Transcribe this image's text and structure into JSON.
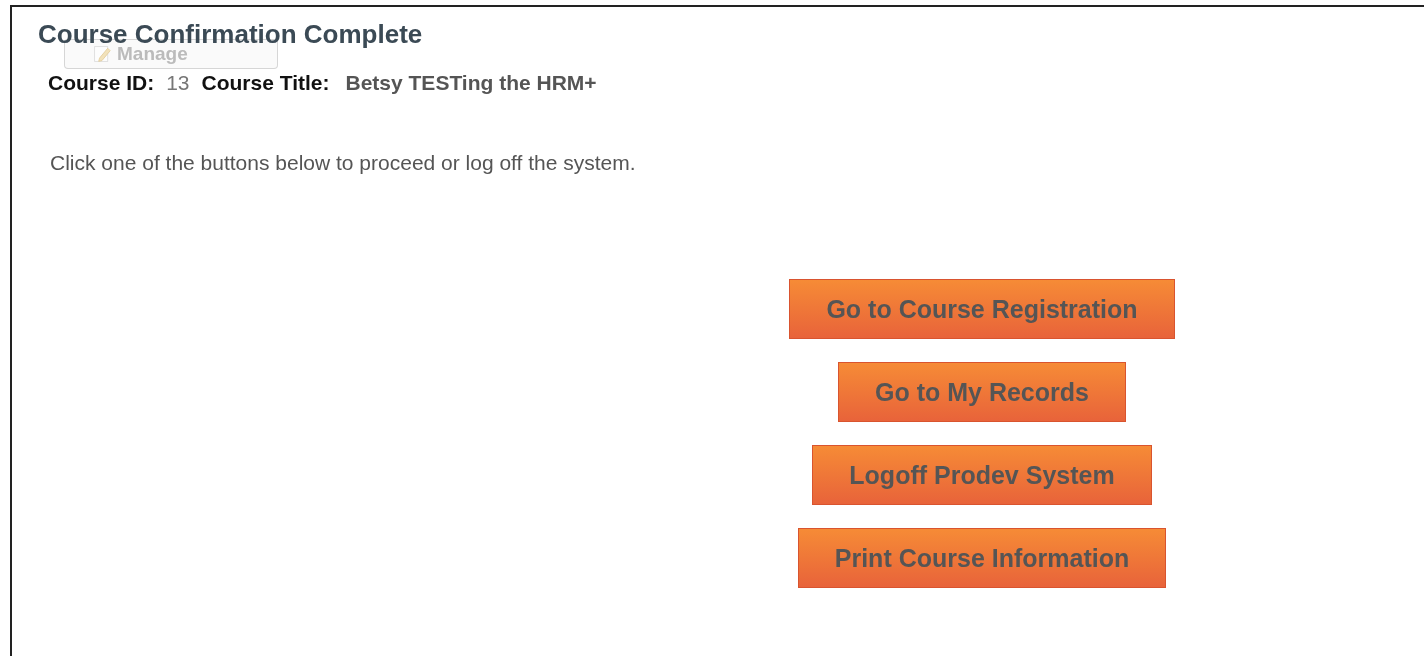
{
  "title": "Course Confirmation Complete",
  "course": {
    "id_label": "Course ID:",
    "id": "13",
    "title_label": "Course Title:",
    "title": "Betsy TESTing the HRM+"
  },
  "manage_button": {
    "label": "Manage",
    "disabled": true
  },
  "instruction": "Click one of the buttons below to proceed or log off the system.",
  "buttons": [
    "Go to Course Registration",
    "Go to My Records",
    "Logoff Prodev System",
    "Print Course Information"
  ]
}
